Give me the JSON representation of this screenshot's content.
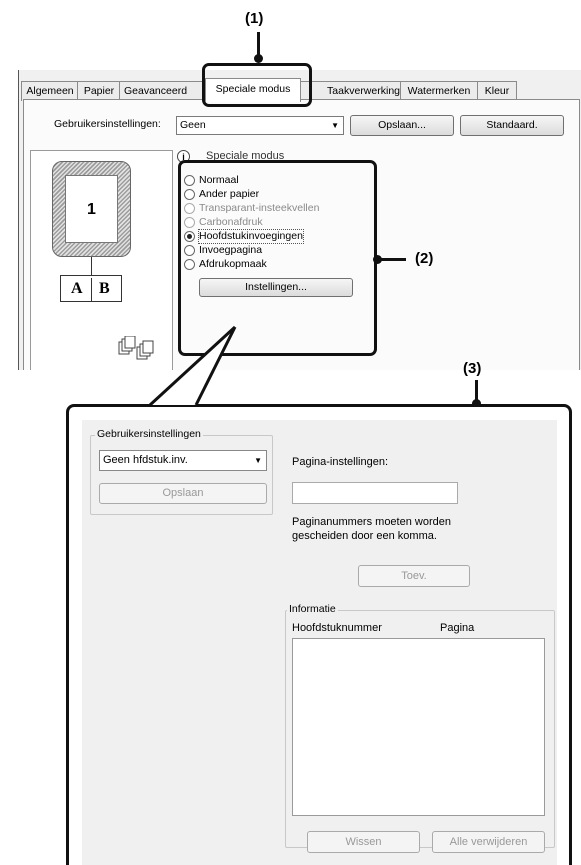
{
  "callouts": {
    "c1": "(1)",
    "c2": "(2)",
    "c3": "(3)"
  },
  "tabs": [
    {
      "label": "Algemeen"
    },
    {
      "label": "Papier"
    },
    {
      "label": "Geavanceerd"
    },
    {
      "label": "Speciale modus"
    },
    {
      "label": "Taakverwerking"
    },
    {
      "label": "Watermerken"
    },
    {
      "label": "Kleur"
    }
  ],
  "user_settings_row": {
    "label": "Gebruikersinstellingen:",
    "value": "Geen",
    "save_label": "Opslaan...",
    "standard_label": "Standaard."
  },
  "preview": {
    "page_number": "1",
    "book_left": "A",
    "book_right": "B"
  },
  "special_modes": {
    "header_label": "Speciale modus",
    "options": [
      {
        "label": "Normaal",
        "enabled": true,
        "checked": false
      },
      {
        "label": "Ander papier",
        "enabled": true,
        "checked": false
      },
      {
        "label": "Transparant-insteekvellen",
        "enabled": false,
        "checked": false
      },
      {
        "label": "Carbonafdruk",
        "enabled": false,
        "checked": false
      },
      {
        "label": "Hoofdstukinvoegingen",
        "enabled": true,
        "checked": true
      },
      {
        "label": "Invoegpagina",
        "enabled": true,
        "checked": false
      },
      {
        "label": "Afdrukopmaak",
        "enabled": true,
        "checked": false
      }
    ],
    "settings_button": "Instellingen..."
  },
  "chapter_dialog": {
    "user_settings_group": "Gebruikersinstellingen",
    "combo_value": "Geen hfdstuk.inv.",
    "save_button": "Opslaan",
    "page_settings_label": "Pagina-instellingen:",
    "page_settings_value": "",
    "hint_line1": "Paginanummers moeten worden",
    "hint_line2": "gescheiden door een komma.",
    "add_button": "Toev.",
    "info_group": "Informatie",
    "col_chapter": "Hoofdstuknummer",
    "col_page": "Pagina",
    "delete_button": "Wissen",
    "delete_all_button": "Alle verwijderen"
  }
}
